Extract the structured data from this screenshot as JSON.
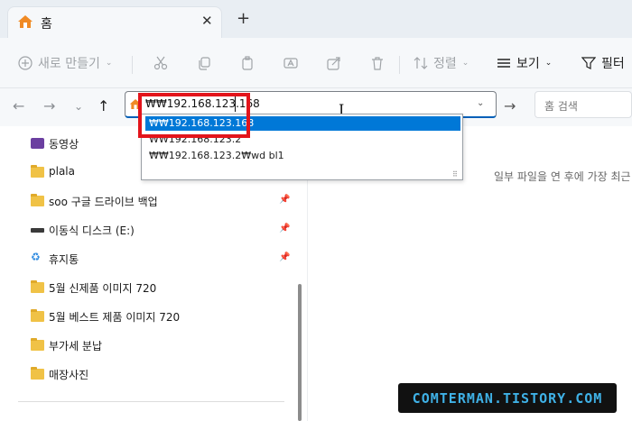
{
  "tab": {
    "title": "홈",
    "close_glyph": "✕",
    "new_tab_glyph": "+",
    "icon": "home-icon"
  },
  "commands": {
    "new": "새로 만들기",
    "sort": "정렬",
    "view": "보기",
    "filter": "필터"
  },
  "nav": {
    "back": "←",
    "forward": "→",
    "recent": "⌄",
    "up": "↑",
    "go": "→"
  },
  "address": {
    "value": "₩₩192.168.123.168",
    "dropdown_glyph": "⌄"
  },
  "search": {
    "placeholder": "홈 검색"
  },
  "autocomplete": [
    "₩₩192.168.123.168",
    "₩₩192.168.123.2",
    "₩₩192.168.123.2₩wd bl1"
  ],
  "sidebar": {
    "items": [
      {
        "label": "동영상",
        "icon": "video-folder-icon",
        "pinned": false
      },
      {
        "label": "plala",
        "icon": "folder-icon",
        "pinned": false
      },
      {
        "label": "soo 구글 드라이브 백업",
        "icon": "folder-icon",
        "pinned": true
      },
      {
        "label": "이동식 디스크 (E:)",
        "icon": "drive-icon",
        "pinned": true
      },
      {
        "label": "휴지통",
        "icon": "recycle-bin-icon",
        "pinned": true
      },
      {
        "label": "5월 신제품 이미지 720",
        "icon": "folder-icon",
        "pinned": false
      },
      {
        "label": "5월 베스트 제품 이미지 720",
        "icon": "folder-icon",
        "pinned": false
      },
      {
        "label": "부가세 분납",
        "icon": "folder-icon",
        "pinned": false
      },
      {
        "label": "매장사진",
        "icon": "folder-icon",
        "pinned": false
      }
    ]
  },
  "main": {
    "empty_message": "일부 파일을 연 후에 가장 최근"
  },
  "watermark": "COMTERMAN.TISTORY.COM",
  "colors": {
    "accent": "#0078d7",
    "highlight": "#e3141b",
    "folder": "#f0c246"
  }
}
